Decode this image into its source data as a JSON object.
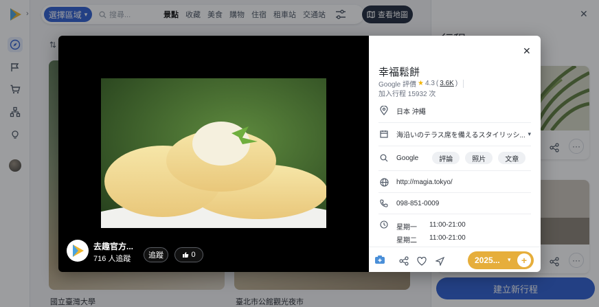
{
  "rail": {
    "expand_glyph": "›",
    "icons": [
      "compass-icon",
      "flag-icon",
      "cart-icon",
      "sitemap-icon",
      "bulb-icon",
      "avatar"
    ]
  },
  "topbar": {
    "region_label": "選擇區域",
    "search_placeholder": "搜尋...",
    "tabs": [
      "景點",
      "收藏",
      "美食",
      "購物",
      "住宿",
      "租車站",
      "交通站"
    ],
    "active_tab": 0,
    "more_glyph": "›",
    "map_button": "查看地圖"
  },
  "right_panel": {
    "title": "行程",
    "new_trip_button": "建立新行程"
  },
  "background_cards": [
    {
      "name": "國立臺灣大學"
    },
    {
      "name": "臺北市公館觀光夜市"
    }
  ],
  "modal": {
    "author": {
      "name": "去趣官方...",
      "followers": "716 人追蹤"
    },
    "follow_button": "追蹤",
    "like_count": "0",
    "place": {
      "name": "幸福鬆餅",
      "rating_source": "Google 評價",
      "rating": "4.3",
      "review_count": "3.6K",
      "added_count": "加入行程 15932 次",
      "location": "日本 沖繩",
      "description": "海沿いのテラス席を備えるスタイリッシ...",
      "google_label": "Google",
      "google_chips": [
        "評論",
        "照片",
        "文章"
      ],
      "website": "http://magia.tokyo/",
      "phone": "098-851-0009",
      "hours": [
        {
          "day": "星期一",
          "time": "11:00-21:00"
        },
        {
          "day": "星期二",
          "time": "11:00-21:00"
        }
      ]
    },
    "add_to_trip_label": "2025...",
    "colors": {
      "accent": "#2f5fd0",
      "gold": "#e6ae3b"
    }
  }
}
